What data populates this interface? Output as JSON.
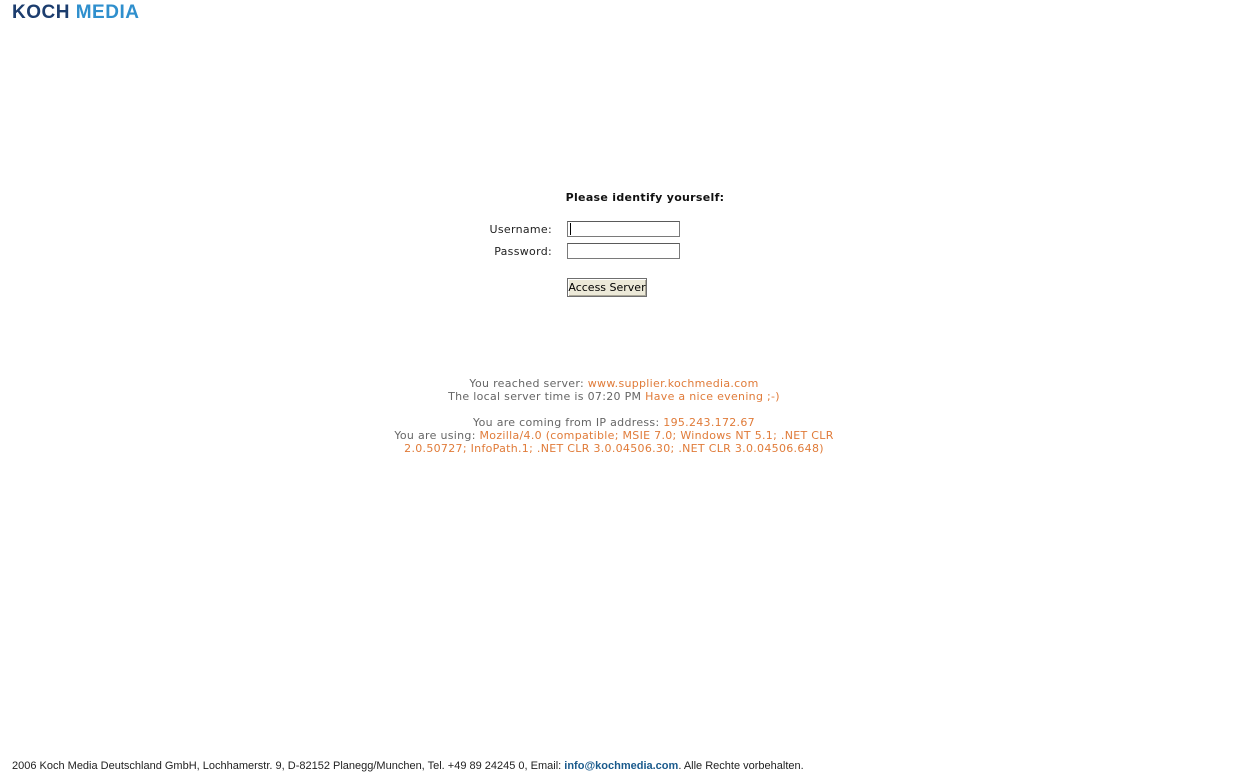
{
  "logo": {
    "part1": "KOCH",
    "part2": "MEDIA",
    "colors": {
      "koch": "#1c3d6e",
      "media": "#2f8fcd"
    }
  },
  "login": {
    "title": "Please identify yourself:",
    "username_label": "Username:",
    "username_value": "",
    "password_label": "Password:",
    "password_value": "",
    "submit_label": "Access Server"
  },
  "info": {
    "server_prefix": "You reached server:",
    "server_value": "www.supplier.kochmedia.com",
    "time_prefix": "The local server time is 07:20 PM",
    "time_greeting": "Have a nice evening ;-)",
    "ip_prefix": "You are coming from IP address:",
    "ip_value": "195.243.172.67",
    "agent_prefix": "You are using:",
    "agent_value": "Mozilla/4.0 (compatible; MSIE 7.0; Windows NT 5.1; .NET CLR 2.0.50727; InfoPath.1; .NET CLR 3.0.04506.30; .NET CLR 3.0.04506.648)",
    "highlight_color": "#e07b39"
  },
  "footer": {
    "text_before": "2006 Koch Media Deutschland GmbH, Lochhamerstr. 9, D-82152 Planegg/Munchen, Tel. +49 89 24245 0, Email:",
    "email": "info@kochmedia.com",
    "text_after": ". Alle Rechte vorbehalten."
  }
}
